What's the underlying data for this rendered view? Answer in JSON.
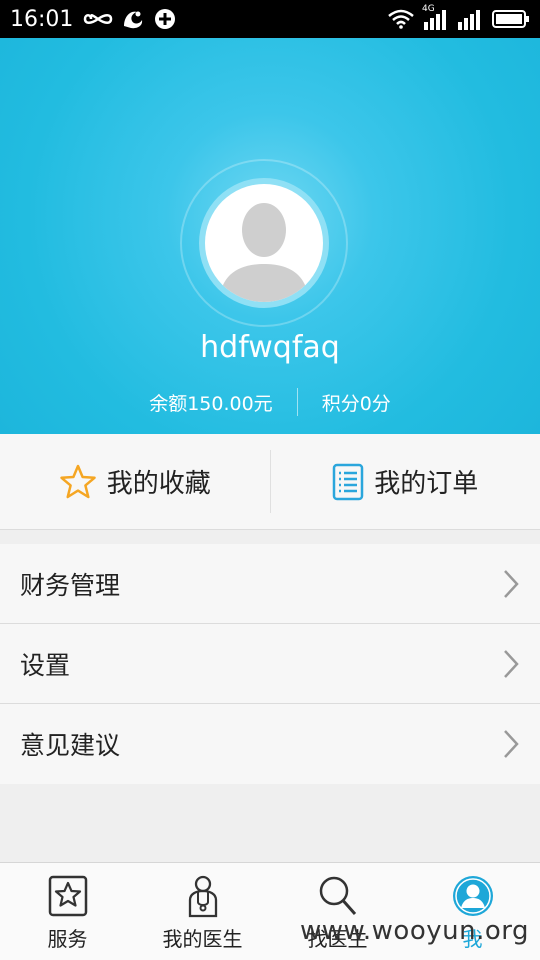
{
  "status_bar": {
    "time": "16:01",
    "network_label": "4G"
  },
  "profile": {
    "username": "hdfwqfaq",
    "balance": "余额150.00元",
    "points": "积分0分"
  },
  "quick_actions": [
    {
      "label": "我的收藏",
      "icon": "star-icon"
    },
    {
      "label": "我的订单",
      "icon": "order-list-icon"
    }
  ],
  "menu": [
    {
      "label": "财务管理"
    },
    {
      "label": "设置"
    },
    {
      "label": "意见建议"
    }
  ],
  "bottom_nav": [
    {
      "label": "服务",
      "icon": "service-star-icon"
    },
    {
      "label": "我的医生",
      "icon": "doctor-icon"
    },
    {
      "label": "找医生",
      "icon": "search-icon"
    },
    {
      "label": "我",
      "icon": "user-icon",
      "active": true
    }
  ],
  "watermark": "www.wooyun.org",
  "colors": {
    "header": "#22bce0",
    "accent": "#1ea7d8",
    "star": "#f5a623"
  }
}
